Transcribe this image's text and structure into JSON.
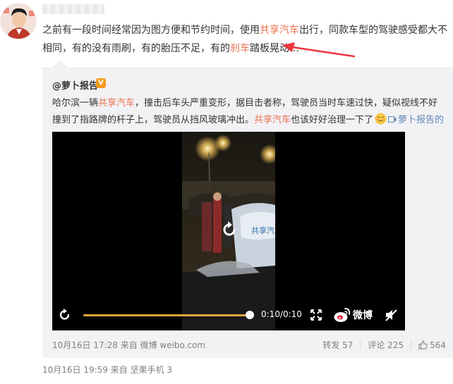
{
  "post": {
    "text_1": "之前有一段时间经常因为图方便和节约时间，使用",
    "brand": "共享汽车",
    "text_2": "出行，同款车型的驾驶感受都大不相同，有的没有雨刷，有的胎压不足，有的",
    "brake": "刹车",
    "text_3": "踏板晃动…",
    "meta": "10月16日 19:59  来自 坚果手机 3"
  },
  "repost": {
    "author": "@萝卜报告",
    "badge": "V",
    "text_1": "哈尔滨一辆",
    "brand": "共享汽车",
    "text_2": "，撞击后车头严重变形，据目击者称，驾驶员当时车速过快，疑似视线不好撞到了指路牌的杆子上，驾驶员从挡风玻璃冲出。",
    "brand2": "共享汽车",
    "text_3": "也该好好治理一下了",
    "video_link": "萝卜报告的微博视频",
    "meta": "10月16日 17:28  来自 微博 weibo.com",
    "repost_label": "转发 57",
    "comment_label": "评论 225",
    "like_count": "564"
  },
  "video": {
    "time": "0:10/0:10",
    "progress": 1.0,
    "logo_text": "微博",
    "car_text": "共享汽"
  },
  "colors": {
    "highlight": "#eb7350",
    "link": "#5f87b6",
    "meta": "#808080",
    "progress": "#e0a53c",
    "annotation": "#e8383d"
  },
  "icons": [
    "avatar",
    "verified-badge",
    "embarrassed-emoji",
    "video-link-icon",
    "replay-icon",
    "play-replay-icon",
    "fullscreen-icon",
    "weibo-logo-icon",
    "mute-icon",
    "like-icon",
    "annotation-arrow"
  ]
}
